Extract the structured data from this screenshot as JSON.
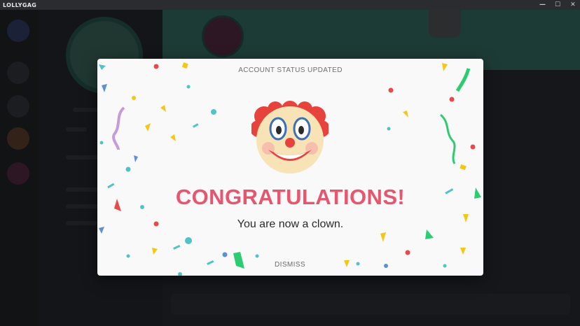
{
  "window": {
    "title": "LOLLYGAG",
    "controls": {
      "minimize": "—",
      "maximize": "☐",
      "close": "✕"
    }
  },
  "modal": {
    "header": "ACCOUNT STATUS UPDATED",
    "icon": "clown-face-emoji",
    "headline": "CONGRATULATIONS!",
    "message": "You are now a clown.",
    "dismiss_label": "DISMISS"
  },
  "colors": {
    "headline": "#e6566e",
    "confetti": [
      "#e84a4a",
      "#f5c518",
      "#4fc3c8",
      "#2ecc71",
      "#6ab04c",
      "#c79bd8",
      "#5b8fd6"
    ]
  }
}
